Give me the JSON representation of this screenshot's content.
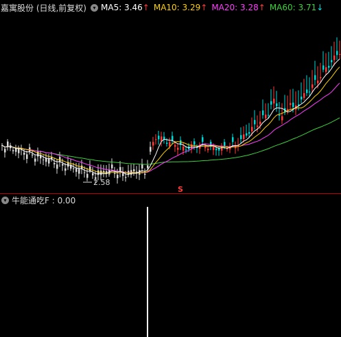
{
  "header": {
    "stock_label": "嘉寓股份 (日线,前复权)",
    "ma": [
      {
        "label": "MA5: 3.46",
        "arrow": "↑",
        "dir": "up",
        "color": "#ffffff"
      },
      {
        "label": "MA10: 3.29",
        "arrow": "↑",
        "dir": "up",
        "color": "#ffd200"
      },
      {
        "label": "MA20: 3.28",
        "arrow": "↑",
        "dir": "up",
        "color": "#ff3cff"
      },
      {
        "label": "MA60: 3.71",
        "arrow": "↓",
        "dir": "down",
        "color": "#3cd23c"
      }
    ]
  },
  "chart": {
    "low_label": "2.58",
    "signal_label": "S",
    "colors": {
      "up": "#ff3a3a",
      "down": "#00d8d8",
      "ma5": "#ffffff",
      "ma10": "#ffd200",
      "ma20": "#ff3cff",
      "ma60": "#3cd23c",
      "divider": "#b40000"
    }
  },
  "indicator": {
    "label": "牛能通吃F : 0.00"
  }
}
